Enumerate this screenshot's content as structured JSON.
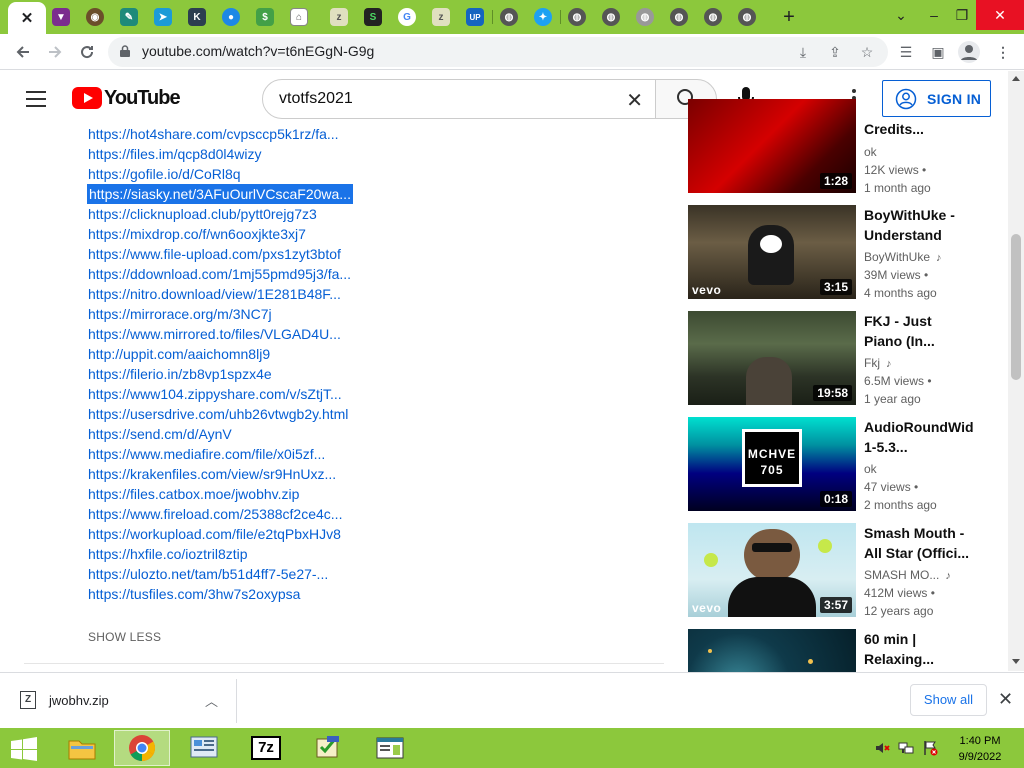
{
  "browser": {
    "active_tab_close": "✕",
    "new_tab": "+",
    "url": "youtube.com/watch?v=t6nEGgN-G9g",
    "window_controls": {
      "dropdown": "⌄",
      "minimize": "–",
      "restore": "❐",
      "close": "✕"
    }
  },
  "youtube": {
    "logo": "YouTube",
    "search_query": "vtotfs2021",
    "sign_in": "SIGN IN"
  },
  "description": {
    "links": [
      "https://hot4share.com/cvpsccp5k1rz/fa...",
      "https://files.im/qcp8d0l4wizy",
      "https://gofile.io/d/CoRl8q",
      "https://siasky.net/3AFuOurlVCscaF20wa...",
      "https://clicknupload.club/pytt0rejg7z3",
      "https://mixdrop.co/f/wn6ooxjkte3xj7",
      "https://www.file-upload.com/pxs1zyt3btof",
      "https://ddownload.com/1mj55pmd95j3/fa...",
      "https://nitro.download/view/1E281B48F...",
      "https://mirrorace.org/m/3NC7j",
      "https://www.mirrored.to/files/VLGAD4U...",
      "http://uppit.com/aaichomn8lj9",
      "https://filerio.in/zb8vp1spzx4e",
      "https://www104.zippyshare.com/v/sZtjT...",
      "https://usersdrive.com/uhb26vtwgb2y.html",
      "https://send.cm/d/AynV",
      "https://www.mediafire.com/file/x0i5zf...",
      "https://krakenfiles.com/view/sr9HnUxz...",
      "https://files.catbox.moe/jwobhv.zip",
      "https://www.fireload.com/25388cf2ce4c...",
      "https://workupload.com/file/e2tqPbxHJv8",
      "https://hxfile.co/ioztril8ztip",
      "https://ulozto.net/tam/b51d4ff7-5e27-...",
      "https://tusfiles.com/3hw7s2oxypsa"
    ],
    "show_less": "SHOW LESS"
  },
  "recommendations": [
    {
      "title_lines": [
        "Credits..."
      ],
      "channel": "ok",
      "views": "12K views",
      "age": "1 month ago",
      "duration": "1:28",
      "music": false,
      "thumb_label": ""
    },
    {
      "title_lines": [
        "BoyWithUke -",
        "Understand"
      ],
      "channel": "BoyWithUke",
      "views": "39M views",
      "age": "4 months ago",
      "duration": "3:15",
      "music": true,
      "thumb_label": "vevo"
    },
    {
      "title_lines": [
        "FKJ - Just",
        "Piano (In..."
      ],
      "channel": "Fkj",
      "views": "6.5M views",
      "age": "1 year ago",
      "duration": "19:58",
      "music": true,
      "thumb_label": ""
    },
    {
      "title_lines": [
        "AudioRoundWid",
        "1-5.3..."
      ],
      "channel": "ok",
      "views": "47 views",
      "age": "2 months ago",
      "duration": "0:18",
      "music": false,
      "thumb_label": "MCHVE 705"
    },
    {
      "title_lines": [
        "Smash Mouth -",
        "All Star (Offici..."
      ],
      "channel": "SMASH MO...",
      "views": "412M views",
      "age": "12 years ago",
      "duration": "3:57",
      "music": true,
      "thumb_label": "vevo"
    },
    {
      "title_lines": [
        "60 min |",
        "Relaxing..."
      ],
      "channel": "",
      "views": "",
      "age": "",
      "duration": "",
      "music": false,
      "thumb_label": ""
    }
  ],
  "download_bar": {
    "file_name": "jwobhv.zip",
    "show_all": "Show all"
  },
  "taskbar": {
    "time": "1:40 PM",
    "date": "9/9/2022",
    "app_7z_label": "7z"
  },
  "colors": {
    "chrome_frame": "#8cc83c",
    "link_blue": "#065fd4",
    "selection": "#1a73e8",
    "yt_red": "#ff0000"
  }
}
